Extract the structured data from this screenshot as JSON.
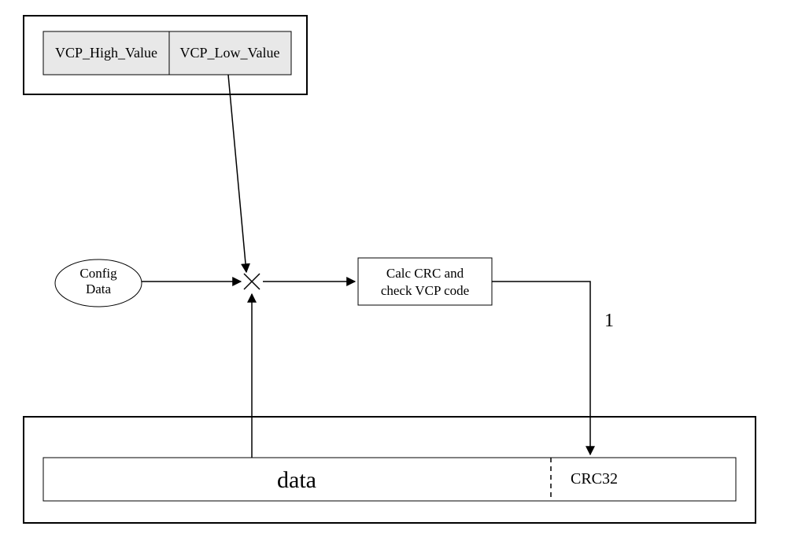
{
  "top_box": {
    "left_label": "VCP_High_Value",
    "right_label": "VCP_Low_Value"
  },
  "config": {
    "label": "Config\nData"
  },
  "process": {
    "label": "Calc CRC and\ncheck VCP code"
  },
  "edge": {
    "one_label": "1"
  },
  "bottom": {
    "data_label": "data",
    "crc_label": "CRC32"
  }
}
